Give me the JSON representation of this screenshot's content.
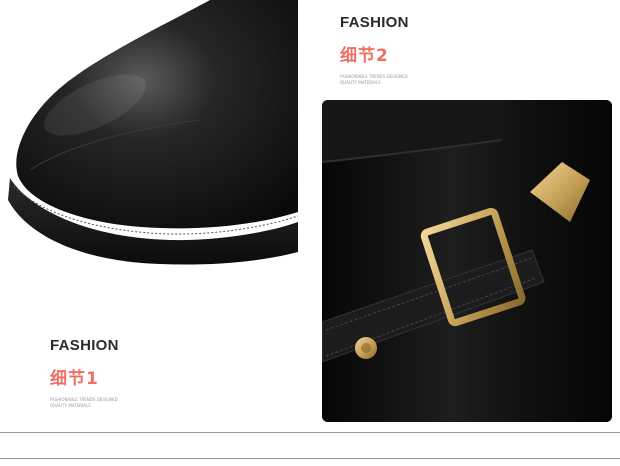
{
  "sections": [
    {
      "heading": "FASHION",
      "detail_label": "细节2",
      "fine_print": [
        "FASHIONABLE TRENDS DESIGNED",
        "QUALITY MATERIALS"
      ]
    },
    {
      "heading": "FASHION",
      "detail_label": "细节1",
      "fine_print": [
        "FASHIONABLE TRENDS DESIGNED",
        "QUALITY MATERIALS"
      ]
    }
  ],
  "images": {
    "toe_detail": "boot-toe-closeup",
    "buckle_detail": "boot-buckle-closeup"
  },
  "colors": {
    "accent": "#ee7063",
    "heading": "#2b2b2b",
    "leather": "#0e0e0e",
    "buckle_gold": "#c9a45a"
  }
}
